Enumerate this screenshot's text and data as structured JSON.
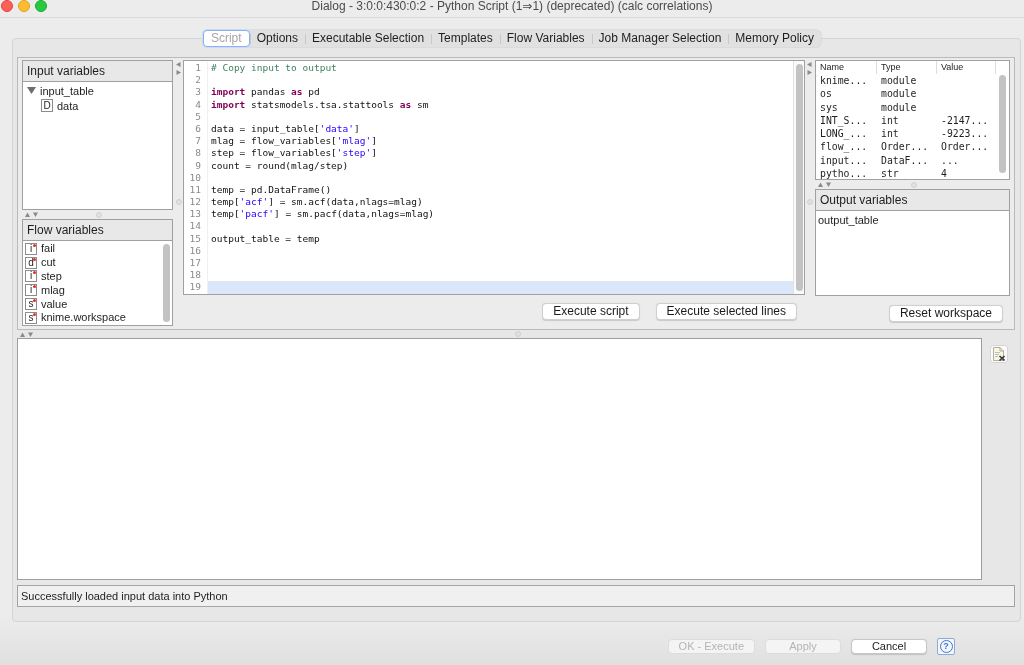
{
  "window": {
    "title": "Dialog - 3:0:0:430:0:2 - Python Script (1⇒1) (deprecated) (calc correlations)"
  },
  "tabs": [
    {
      "label": "Script",
      "selected": true
    },
    {
      "label": "Options",
      "selected": false
    },
    {
      "label": "Executable Selection",
      "selected": false
    },
    {
      "label": "Templates",
      "selected": false
    },
    {
      "label": "Flow Variables",
      "selected": false
    },
    {
      "label": "Job Manager Selection",
      "selected": false
    },
    {
      "label": "Memory Policy",
      "selected": false
    }
  ],
  "input_variables": {
    "title": "Input variables",
    "tree": [
      {
        "label": "input_table",
        "expanded": true,
        "children": [
          {
            "label": "data",
            "type_letter": "D"
          }
        ]
      }
    ]
  },
  "flow_variables": {
    "title": "Flow variables",
    "items": [
      {
        "type_letter": "i",
        "name": "fail"
      },
      {
        "type_letter": "d",
        "name": "cut"
      },
      {
        "type_letter": "i",
        "name": "step"
      },
      {
        "type_letter": "i",
        "name": "mlag"
      },
      {
        "type_letter": "s",
        "name": "value"
      },
      {
        "type_letter": "s",
        "name": "knime.workspace"
      }
    ]
  },
  "editor": {
    "lines": [
      {
        "number": "1",
        "current": false,
        "segments": [
          {
            "kind": "comment",
            "text": "# Copy input to output"
          }
        ]
      },
      {
        "number": "2",
        "current": false
      },
      {
        "number": "3",
        "current": false,
        "segments": [
          {
            "kind": "keyword",
            "text": "import"
          },
          {
            "kind": "plain",
            "text": " pandas "
          },
          {
            "kind": "keyword",
            "text": "as"
          },
          {
            "kind": "plain",
            "text": " pd"
          }
        ]
      },
      {
        "number": "4",
        "current": false,
        "segments": [
          {
            "kind": "keyword",
            "text": "import"
          },
          {
            "kind": "plain",
            "text": " statsmodels.tsa.stattools "
          },
          {
            "kind": "keyword",
            "text": "as"
          },
          {
            "kind": "plain",
            "text": " sm"
          }
        ]
      },
      {
        "number": "5",
        "current": false
      },
      {
        "number": "6",
        "current": false,
        "segments": [
          {
            "kind": "plain",
            "text": "data = input_table["
          },
          {
            "kind": "string",
            "text": "'data'"
          },
          {
            "kind": "plain",
            "text": "]"
          }
        ]
      },
      {
        "number": "7",
        "current": false,
        "segments": [
          {
            "kind": "plain",
            "text": "mlag = flow_variables["
          },
          {
            "kind": "string",
            "text": "'mlag'"
          },
          {
            "kind": "plain",
            "text": "]"
          }
        ]
      },
      {
        "number": "8",
        "current": false,
        "segments": [
          {
            "kind": "plain",
            "text": "step = flow_variables["
          },
          {
            "kind": "string",
            "text": "'step'"
          },
          {
            "kind": "plain",
            "text": "]"
          }
        ]
      },
      {
        "number": "9",
        "current": false,
        "segments": [
          {
            "kind": "plain",
            "text": "count = round(mlag/step)"
          }
        ]
      },
      {
        "number": "10",
        "current": false
      },
      {
        "number": "11",
        "current": false,
        "segments": [
          {
            "kind": "plain",
            "text": "temp = pd.DataFrame()"
          }
        ]
      },
      {
        "number": "12",
        "current": false,
        "segments": [
          {
            "kind": "plain",
            "text": "temp["
          },
          {
            "kind": "string",
            "text": "'acf'"
          },
          {
            "kind": "plain",
            "text": "] = sm.acf(data,nlags=mlag)"
          }
        ]
      },
      {
        "number": "13",
        "current": false,
        "segments": [
          {
            "kind": "plain",
            "text": "temp["
          },
          {
            "kind": "string",
            "text": "'pacf'"
          },
          {
            "kind": "plain",
            "text": "] = sm.pacf(data,nlags=mlag)"
          }
        ]
      },
      {
        "number": "14",
        "current": false
      },
      {
        "number": "15",
        "current": false,
        "segments": [
          {
            "kind": "plain",
            "text": "output_table = temp"
          }
        ]
      },
      {
        "number": "16",
        "current": false
      },
      {
        "number": "17",
        "current": false
      },
      {
        "number": "18",
        "current": false
      },
      {
        "number": "19",
        "current": true
      }
    ]
  },
  "editor_buttons": [
    {
      "label": "Execute script"
    },
    {
      "label": "Execute selected lines"
    }
  ],
  "workspace": {
    "columns": [
      "Name",
      "Type",
      "Value"
    ],
    "rows": [
      {
        "name": "knime...",
        "type": "module"
      },
      {
        "name": "os",
        "type": "module"
      },
      {
        "name": "sys",
        "type": "module"
      },
      {
        "name": "INT_S...",
        "type": "int",
        "value": "-2147..."
      },
      {
        "name": "LONG_...",
        "type": "int",
        "value": "-9223..."
      },
      {
        "name": "flow_...",
        "type": "Order...",
        "value": "Order..."
      },
      {
        "name": "input...",
        "type": "DataF...",
        "value": "..."
      },
      {
        "name": "pytho...",
        "type": "str",
        "value": "4"
      }
    ]
  },
  "output_variables": {
    "title": "Output variables",
    "items": [
      "output_table"
    ]
  },
  "reset_button": {
    "label": "Reset workspace"
  },
  "status_bar": {
    "text": "Successfully loaded input data into Python"
  },
  "dialog_buttons": [
    {
      "label": "OK - Execute",
      "disabled": true
    },
    {
      "label": "Apply",
      "disabled": true
    },
    {
      "label": "Cancel",
      "disabled": false
    }
  ],
  "help_button": {
    "label": "?"
  }
}
